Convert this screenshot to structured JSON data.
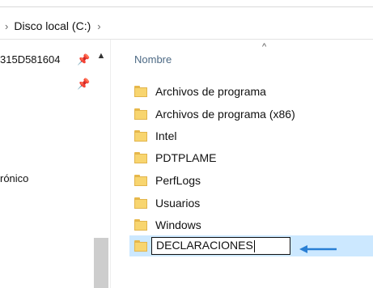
{
  "address": {
    "crumbs": [
      "Disco local (C:)"
    ],
    "separator": "›"
  },
  "nav": {
    "items": [
      {
        "label": "315D581604"
      },
      {
        "label": "rónico"
      }
    ]
  },
  "list": {
    "column_header": "Nombre",
    "folders": [
      {
        "name": "Archivos de programa"
      },
      {
        "name": "Archivos de programa (x86)"
      },
      {
        "name": "Intel"
      },
      {
        "name": "PDTPLAME"
      },
      {
        "name": "PerfLogs"
      },
      {
        "name": "Usuarios"
      },
      {
        "name": "Windows"
      }
    ],
    "renaming": {
      "value": "DECLARACIONES"
    }
  },
  "icons": {
    "pin": "pin-icon",
    "folder": "folder-icon",
    "arrow": "blue-arrow-left-icon"
  },
  "colors": {
    "selection": "#cce8ff",
    "header_text": "#4d6a85",
    "arrow": "#2a7fd4",
    "folder": "#f8d56f"
  }
}
